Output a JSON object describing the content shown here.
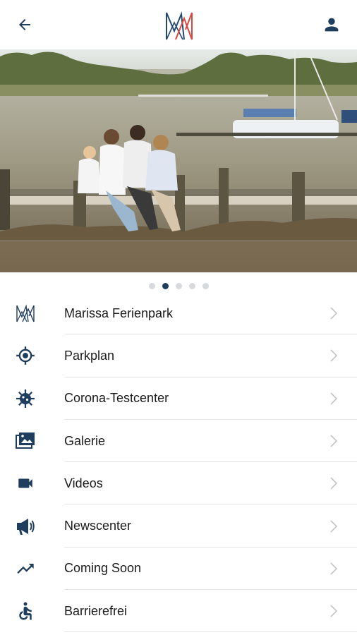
{
  "colors": {
    "primary": "#1f3d5c",
    "logo_red": "#d9473f",
    "logo_blue": "#244a6e",
    "chevron": "#c4c4c4"
  },
  "header": {
    "back_icon": "arrow-left-icon",
    "logo": "marissa-logo",
    "user_icon": "account-icon"
  },
  "carousel": {
    "slide_count": 5,
    "active_index": 1
  },
  "menu": {
    "items": [
      {
        "label": "Marissa Ferienpark",
        "icon": "marissa-logo-icon"
      },
      {
        "label": "Parkplan",
        "icon": "location-target-icon"
      },
      {
        "label": "Corona-Testcenter",
        "icon": "virus-icon"
      },
      {
        "label": "Galerie",
        "icon": "gallery-icon"
      },
      {
        "label": "Videos",
        "icon": "videocam-icon"
      },
      {
        "label": "Newscenter",
        "icon": "megaphone-icon"
      },
      {
        "label": "Coming Soon",
        "icon": "trending-up-icon"
      },
      {
        "label": "Barrierefrei",
        "icon": "wheelchair-icon"
      }
    ]
  }
}
